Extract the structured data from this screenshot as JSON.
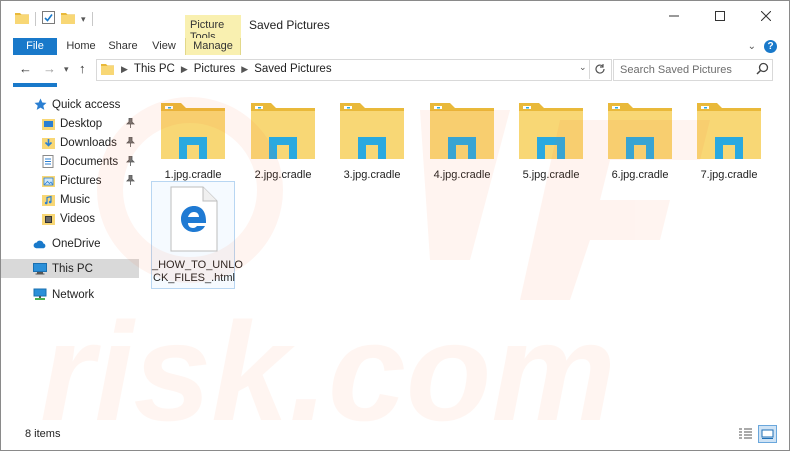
{
  "window": {
    "title": "Saved Pictures",
    "context_tab_group": "Picture Tools"
  },
  "ribbon": {
    "tabs": [
      "File",
      "Home",
      "Share",
      "View",
      "Manage"
    ]
  },
  "address": {
    "crumbs": [
      "This PC",
      "Pictures",
      "Saved Pictures"
    ]
  },
  "search": {
    "placeholder": "Search Saved Pictures"
  },
  "nav": {
    "quick_access": "Quick access",
    "items": [
      "Desktop",
      "Downloads",
      "Documents",
      "Pictures",
      "Music",
      "Videos"
    ],
    "onedrive": "OneDrive",
    "this_pc": "This PC",
    "network": "Network"
  },
  "files": [
    {
      "name": "1.jpg.cradle"
    },
    {
      "name": "2.jpg.cradle"
    },
    {
      "name": "3.jpg.cradle"
    },
    {
      "name": "4.jpg.cradle"
    },
    {
      "name": "5.jpg.cradle"
    },
    {
      "name": "6.jpg.cradle"
    },
    {
      "name": "7.jpg.cradle"
    },
    {
      "name_line1": "_HOW_TO_UNLO",
      "name_line2": "CK_FILES_.html"
    }
  ],
  "status": {
    "count": "8 items"
  },
  "watermark": "risk.com",
  "colors": {
    "accent": "#1979ca",
    "context_tab": "#f9f0b0",
    "folder": "#f8d775",
    "folder_dark": "#e9b93a",
    "badge": "#2aa9e0"
  }
}
